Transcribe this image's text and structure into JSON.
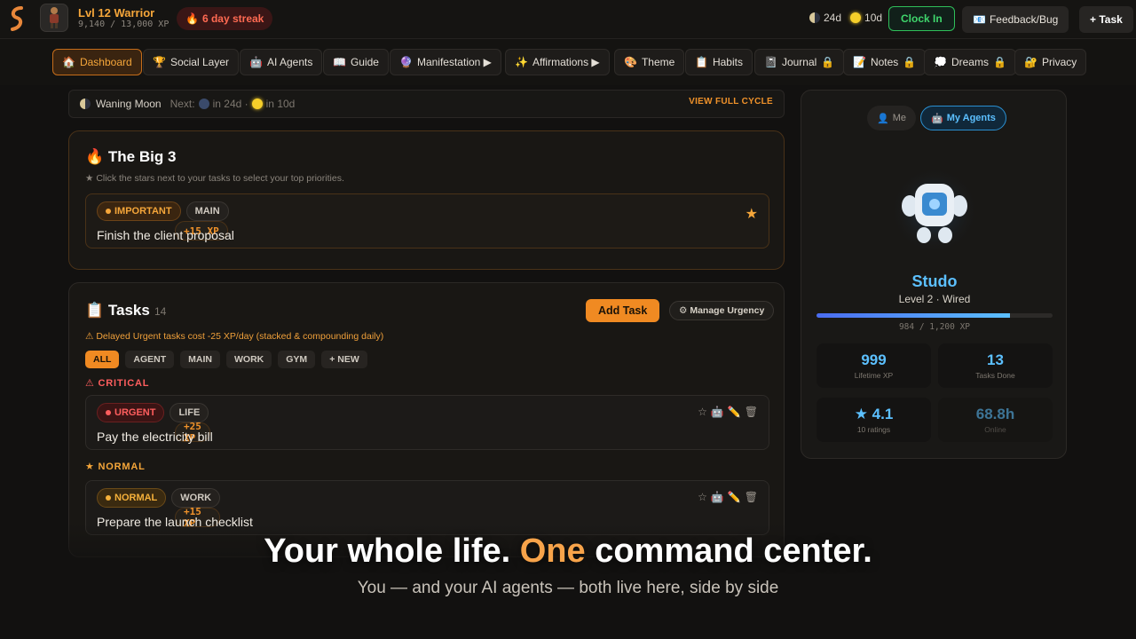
{
  "header": {
    "level_label": "Lvl 12 Warrior",
    "xp_label": "9,140 / 13,000 XP",
    "streak_label": "6 day streak",
    "moon_countdown": "24d",
    "sun_countdown": "10d",
    "clock_in_label": "Clock In",
    "feedback_label": "Feedback/Bug",
    "add_task_label": "+ Task"
  },
  "nav": {
    "items": [
      {
        "label": "Dashboard",
        "icon": "🏠"
      },
      {
        "label": "Social Layer",
        "icon": "🏆"
      },
      {
        "label": "AI Agents",
        "icon": "🤖"
      },
      {
        "label": "Guide",
        "icon": "📖"
      },
      {
        "label": "Manifestation ▶",
        "icon": "🔮"
      },
      {
        "label": "Affirmations ▶",
        "icon": "✨"
      },
      {
        "label": "Theme",
        "icon": "🎨"
      },
      {
        "label": "Habits",
        "icon": "📋"
      },
      {
        "label": "Journal",
        "icon": "📓"
      },
      {
        "label": "Notes",
        "icon": "📝"
      },
      {
        "label": "Dreams",
        "icon": "💭"
      },
      {
        "label": "Privacy",
        "icon": "🔐"
      }
    ]
  },
  "moon": {
    "phase": "Waning Moon",
    "next_label": "Next:",
    "next_moon": "in 24d ·",
    "next_sun": "in 10d",
    "view_cycle": "VIEW FULL CYCLE"
  },
  "big3": {
    "title": "🔥 The Big 3",
    "hint": "★ Click the stars next to your tasks to select your top priorities.",
    "item": {
      "tags": [
        "IMPORTANT",
        "MAIN",
        "+15 XP"
      ],
      "text": "Finish the client proposal"
    }
  },
  "tasks": {
    "title": "📋 Tasks",
    "count": "14",
    "add_label": "Add Task",
    "urgency_label": "⚙ Manage Urgency",
    "warning": "⚠ Delayed Urgent tasks cost -25 XP/day (stacked & compounding daily)",
    "filters": [
      "ALL",
      "AGENT",
      "MAIN",
      "WORK",
      "GYM",
      "+ NEW"
    ],
    "critical_label": "⚠ CRITICAL",
    "normal_label": "★ NORMAL",
    "critical_item": {
      "tags": [
        "URGENT",
        "LIFE",
        "+25 XP"
      ],
      "text": "Pay the electricity bill"
    },
    "normal_item": {
      "tags": [
        "NORMAL",
        "WORK",
        "+15 XP"
      ],
      "text": "Prepare the launch checklist"
    }
  },
  "agent": {
    "tab_me": "Me",
    "tab_agents": "My Agents",
    "name": "Studo",
    "level": "Level 2 · Wired",
    "xp_text": "984 / 1,200 XP",
    "xp_progress": 0.82,
    "stats": [
      {
        "value": "999",
        "label": "Lifetime XP"
      },
      {
        "value": "13",
        "label": "Tasks Done"
      },
      {
        "value": "★ 4.1",
        "label": "10 ratings"
      },
      {
        "value": "68.8h",
        "label": "Online"
      }
    ]
  },
  "overlay": {
    "hero_before": "Your whole life. ",
    "hero_accent": "One",
    "hero_after": " command center.",
    "subtitle": "You — and your AI agents — both live here, side by side"
  },
  "colors": {
    "accent": "#f08a22",
    "agent_blue": "#5cc0ff",
    "urgent": "#ff5e5e",
    "success": "#3fd66c"
  }
}
